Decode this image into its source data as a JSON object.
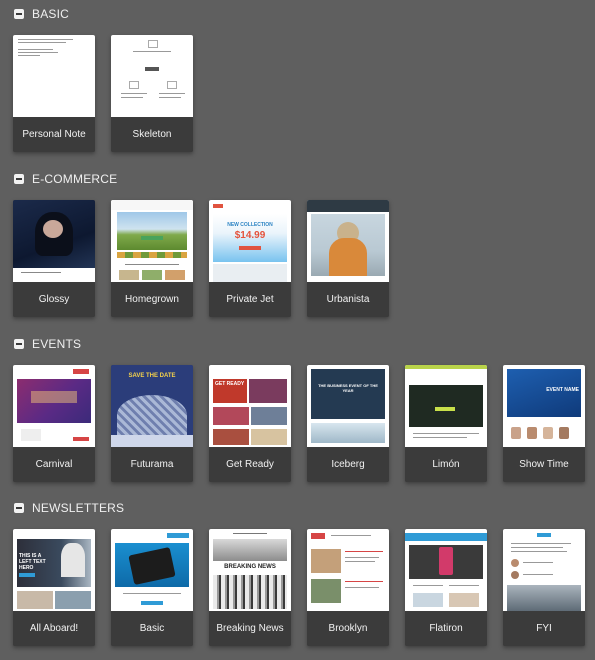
{
  "sections": {
    "basic": {
      "title": "BASIC",
      "cards": [
        "Personal Note",
        "Skeleton"
      ]
    },
    "ecommerce": {
      "title": "E-COMMERCE",
      "cards": [
        "Glossy",
        "Homegrown",
        "Private Jet",
        "Urbanista"
      ]
    },
    "events": {
      "title": "EVENTS",
      "cards": [
        "Carnival",
        "Futurama",
        "Get Ready",
        "Iceberg",
        "Limón",
        "Show Time"
      ]
    },
    "newsletters": {
      "title": "NEWSLETTERS",
      "cards": [
        "All Aboard!",
        "Basic",
        "Breaking News",
        "Brooklyn",
        "Flatiron",
        "FYI"
      ]
    }
  },
  "thumb_text": {
    "private_jet_headline": "NEW COLLECTION",
    "private_jet_price": "$14.99",
    "futurama_headline": "SAVE THE DATE",
    "get_ready_headline": "GET READY",
    "iceberg_headline": "THE BUSINESS EVENT OF THE YEAR",
    "show_time_headline": "EVENT NAME",
    "all_aboard_headline": "THIS IS A LEFT TEXT HERO",
    "breaking_news_headline": "BREAKING NEWS"
  },
  "colors": {
    "background": "#5f5f5f",
    "card_label_bg": "#3b3b3b",
    "accent_blue": "#2f9bd6",
    "accent_red": "#d64545"
  }
}
